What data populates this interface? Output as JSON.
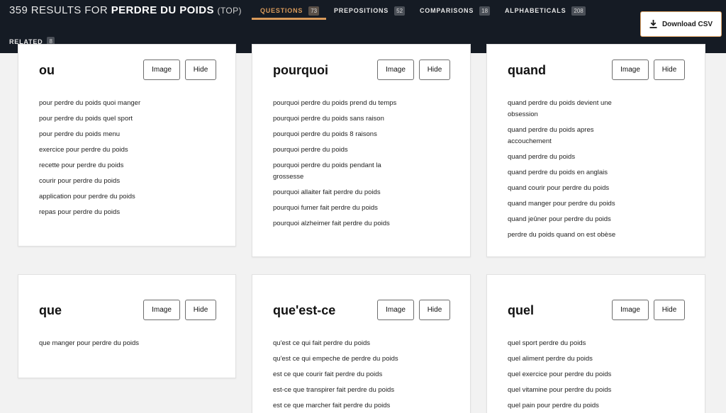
{
  "header": {
    "results_prefix": "359 RESULTS FOR",
    "query": "PERDRE DU POIDS",
    "scope": "(TOP)",
    "download_label": "Download CSV",
    "download_icon": "download-icon"
  },
  "tabs": [
    {
      "label": "QUESTIONS",
      "count": "73",
      "active": true
    },
    {
      "label": "PREPOSITIONS",
      "count": "52",
      "active": false
    },
    {
      "label": "COMPARISONS",
      "count": "18",
      "active": false
    },
    {
      "label": "ALPHABETICALS",
      "count": "208",
      "active": false
    }
  ],
  "related": {
    "label": "RELATED",
    "count": "8"
  },
  "buttons": {
    "image": "Image",
    "hide": "Hide"
  },
  "colors": {
    "header_bg": "#151b24",
    "accent": "#d99a5a",
    "page_bg": "#f2f2f2"
  },
  "cards": [
    {
      "title": "ou",
      "items": [
        "pour perdre du poids quoi manger",
        "pour perdre du poids quel sport",
        "pour perdre du poids menu",
        "exercice pour perdre du poids",
        "recette pour perdre du poids",
        "courir pour perdre du poids",
        "application pour perdre du poids",
        "repas pour perdre du poids"
      ]
    },
    {
      "title": "pourquoi",
      "items": [
        "pourquoi perdre du poids prend du temps",
        "pourquoi perdre du poids sans raison",
        "pourquoi perdre du poids 8 raisons",
        "pourquoi perdre du poids",
        "pourquoi perdre du poids pendant la grossesse",
        "pourquoi allaiter fait perdre du poids",
        "pourquoi fumer fait perdre du poids",
        "pourquoi alzheimer fait perdre du poids"
      ]
    },
    {
      "title": "quand",
      "items": [
        "quand perdre du poids devient une obsession",
        "quand perdre du poids apres accouchement",
        "quand perdre du poids",
        "quand perdre du poids en anglais",
        "quand courir pour perdre du poids",
        "quand manger pour perdre du poids",
        "quand jeûner pour perdre du poids",
        "perdre du poids quand on est obèse"
      ]
    },
    {
      "title": "que",
      "items": [
        "que manger pour perdre du poids"
      ]
    },
    {
      "title": "que'est-ce",
      "items": [
        "qu'est ce qui fait perdre du poids",
        "qu'est ce qui empeche de perdre du poids",
        "est ce que courir fait perdre du poids",
        "est-ce que transpirer fait perdre du poids",
        "est ce que marcher fait perdre du poids"
      ]
    },
    {
      "title": "quel",
      "items": [
        "quel sport perdre du poids",
        "quel aliment perdre du poids",
        "quel exercice pour perdre du poids",
        "quel vitamine pour perdre du poids",
        "quel pain pour perdre du poids"
      ]
    }
  ]
}
